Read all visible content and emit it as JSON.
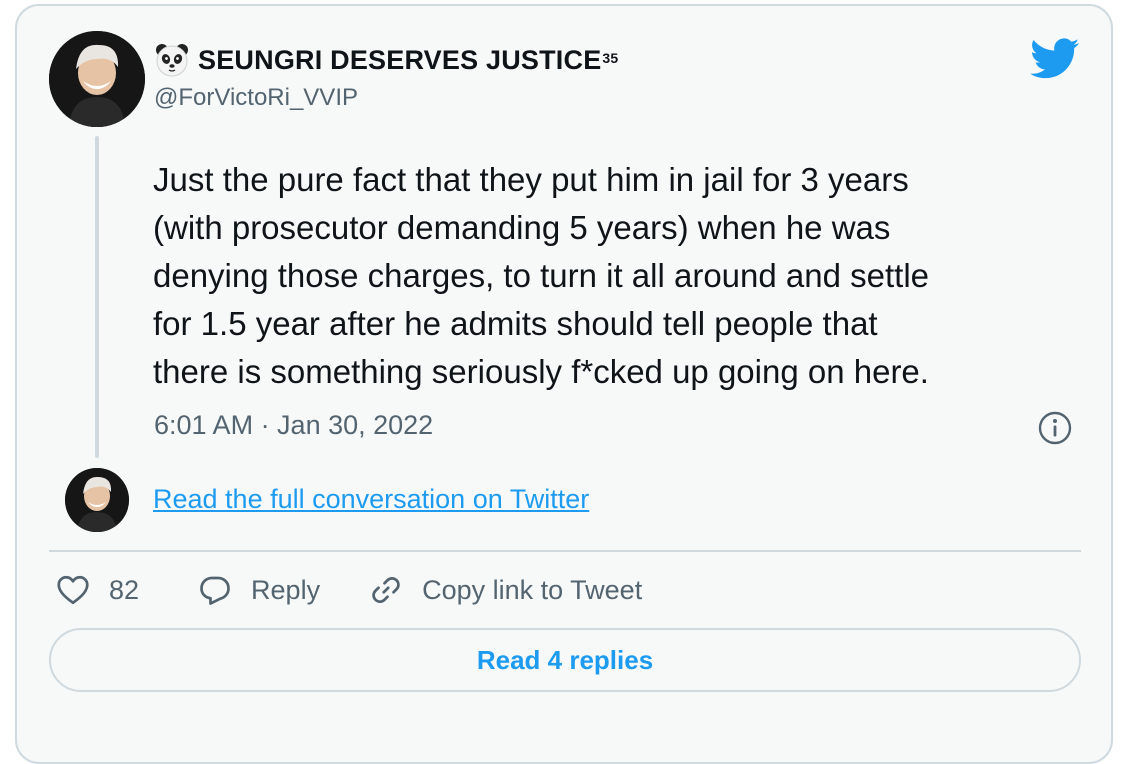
{
  "author": {
    "display_name": "SEUNGRI DESERVES JUSTICE",
    "display_name_superscript": "35",
    "name_emoji_icon": "panda-face-icon",
    "handle": "@ForVictoRi_VVIP"
  },
  "brand_icon": "twitter-bird-icon",
  "brand_color": "#1d9bf0",
  "tweet": {
    "lines": [
      "Just the pure fact that they put him in jail for 3 years",
      "(with prosecutor demanding 5 years) when he was",
      "denying those charges, to turn it all around and settle",
      "for 1.5 year after he admits should tell people that",
      "there is something seriously f*cked up going on here."
    ],
    "timestamp": "6:01 AM · Jan 30, 2022",
    "info_icon": "info-icon"
  },
  "conversation_link": "Read the full conversation on Twitter",
  "actions": {
    "like_count": "82",
    "reply_label": "Reply",
    "copy_link_label": "Copy link to Tweet"
  },
  "read_replies_label": "Read 4 replies"
}
